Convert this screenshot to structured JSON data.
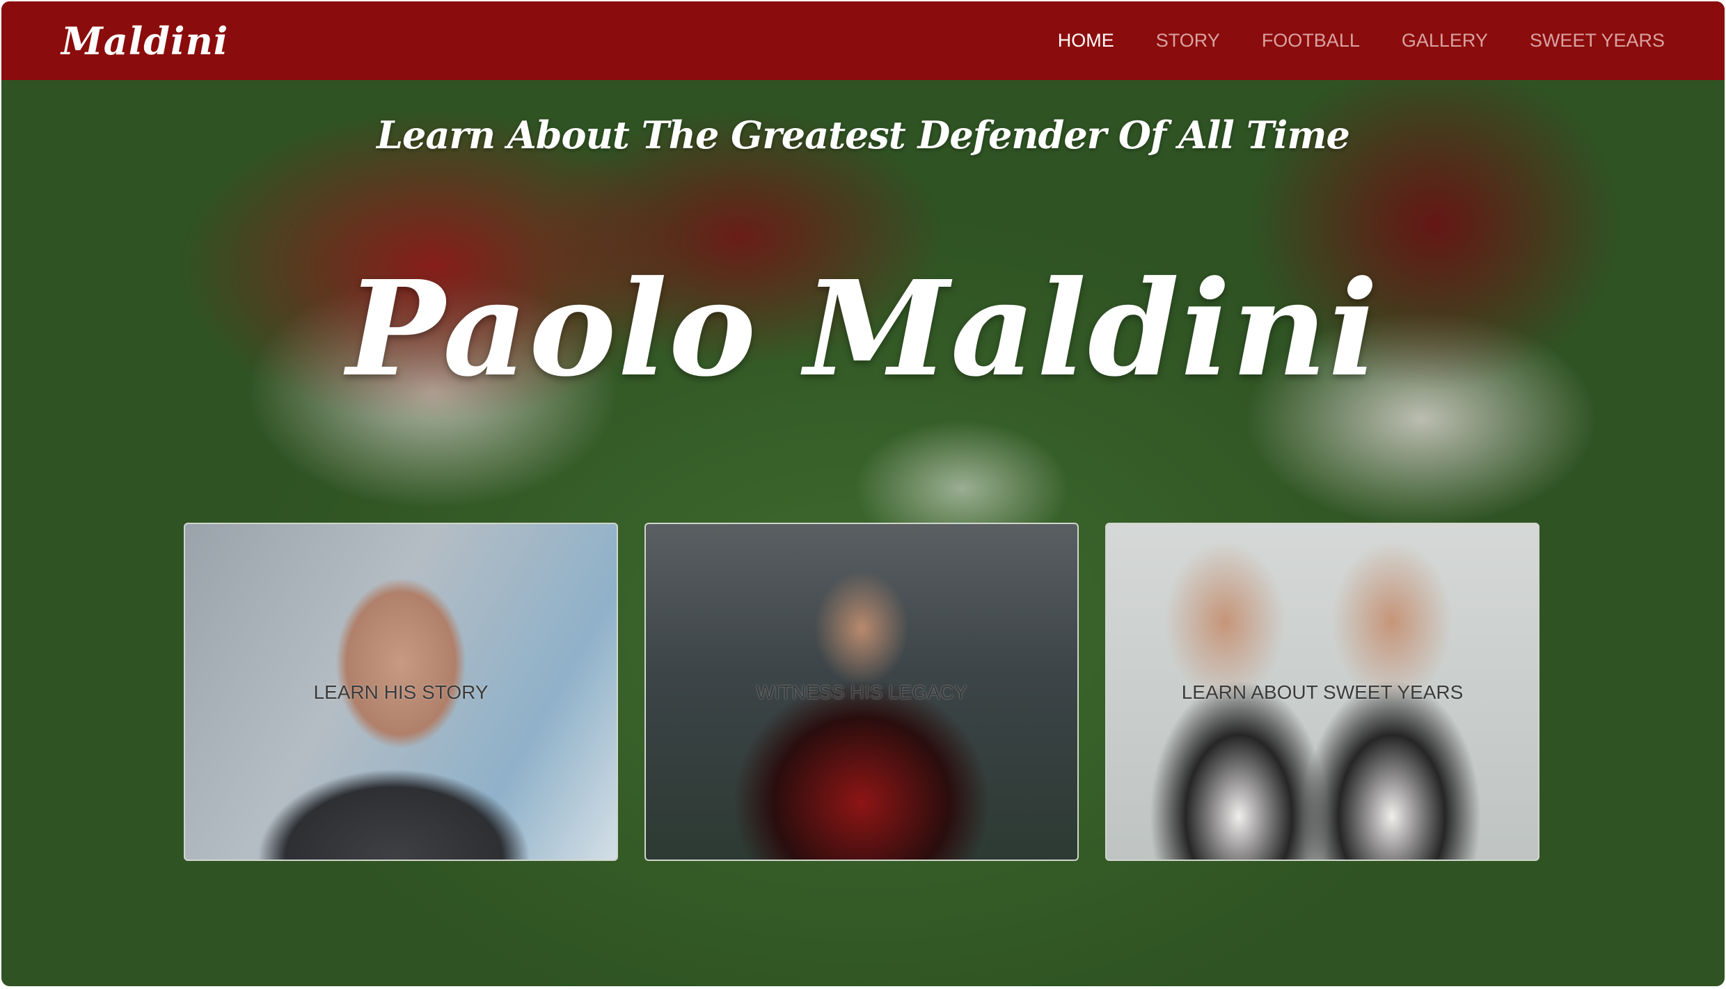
{
  "navbar": {
    "brand": "Maldini",
    "links": [
      {
        "label": "HOME",
        "active": true
      },
      {
        "label": "STORY",
        "active": false
      },
      {
        "label": "FOOTBALL",
        "active": false
      },
      {
        "label": "GALLERY",
        "active": false
      },
      {
        "label": "SWEET YEARS",
        "active": false
      }
    ]
  },
  "hero": {
    "tagline": "Learn About The Greatest Defender Of All Time",
    "title": "Paolo Maldini"
  },
  "cards": [
    {
      "label": "LEARN HIS STORY"
    },
    {
      "label": "WITNESS HIS LEGACY"
    },
    {
      "label": "LEARN ABOUT SWEET YEARS"
    }
  ],
  "colors": {
    "navbar_bg": "#8b0c0c",
    "nav_inactive": "#d9a2a2",
    "nav_active": "#ffffff"
  }
}
